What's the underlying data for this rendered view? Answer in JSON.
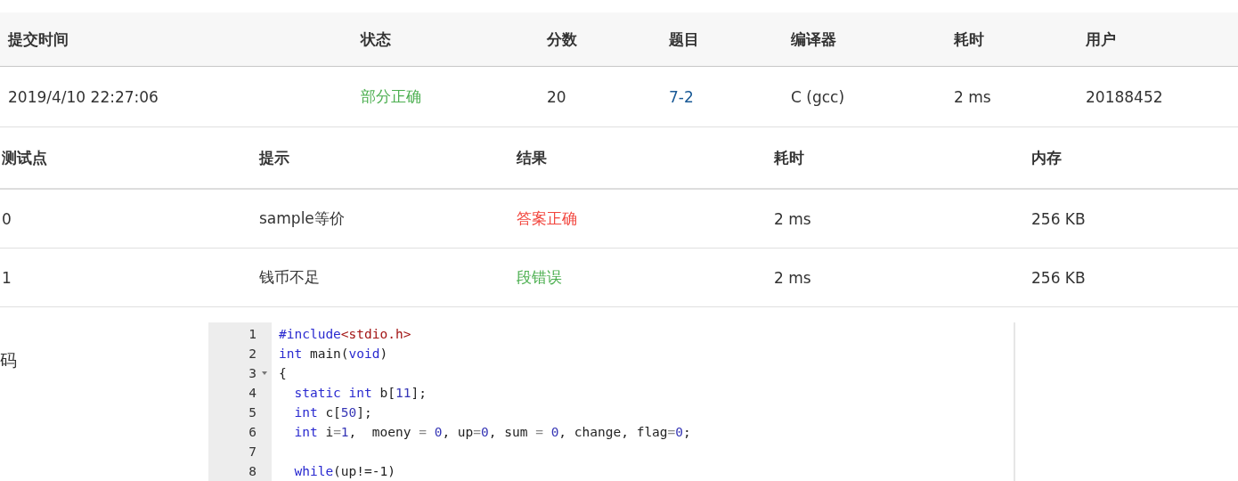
{
  "submission": {
    "columns": [
      "提交时间",
      "状态",
      "分数",
      "题目",
      "编译器",
      "耗时",
      "用户"
    ],
    "row": {
      "time": "2019/4/10 22:27:06",
      "status": {
        "text": "部分正确",
        "color": "#4caf50"
      },
      "score": "20",
      "problem": "7-2",
      "compiler": "C (gcc)",
      "duration": "2 ms",
      "user": "20188452"
    }
  },
  "testcases": {
    "columns": [
      "测试点",
      "提示",
      "结果",
      "耗时",
      "内存"
    ],
    "rows": [
      {
        "id": "0",
        "hint": "sample等价",
        "result": {
          "text": "答案正确",
          "color": "#f2453d"
        },
        "duration": "2 ms",
        "memory": "256 KB"
      },
      {
        "id": "1",
        "hint": "钱币不足",
        "result": {
          "text": "段错误",
          "color": "#4caf50"
        },
        "duration": "2 ms",
        "memory": "256 KB"
      }
    ]
  },
  "code": {
    "label": "码",
    "lines": [
      {
        "number": "1",
        "foldable": false,
        "tokens": [
          {
            "kind": "meta",
            "text": "#include"
          },
          {
            "kind": "str",
            "text": "<stdio.h>"
          }
        ]
      },
      {
        "number": "2",
        "foldable": false,
        "tokens": [
          {
            "kind": "kw",
            "text": "int"
          },
          {
            "kind": "plain",
            "text": " main("
          },
          {
            "kind": "kw",
            "text": "void"
          },
          {
            "kind": "plain",
            "text": ")"
          }
        ]
      },
      {
        "number": "3",
        "foldable": true,
        "tokens": [
          {
            "kind": "plain",
            "text": "{"
          }
        ]
      },
      {
        "number": "4",
        "foldable": false,
        "tokens": [
          {
            "kind": "kw",
            "text": "  static int"
          },
          {
            "kind": "plain",
            "text": " b["
          },
          {
            "kind": "num",
            "text": "11"
          },
          {
            "kind": "plain",
            "text": "];"
          }
        ]
      },
      {
        "number": "5",
        "foldable": false,
        "tokens": [
          {
            "kind": "kw",
            "text": "  int"
          },
          {
            "kind": "plain",
            "text": " c["
          },
          {
            "kind": "num",
            "text": "50"
          },
          {
            "kind": "plain",
            "text": "];"
          }
        ]
      },
      {
        "number": "6",
        "foldable": false,
        "tokens": [
          {
            "kind": "kw",
            "text": "  int"
          },
          {
            "kind": "plain",
            "text": " i"
          },
          {
            "kind": "op",
            "text": "="
          },
          {
            "kind": "num",
            "text": "1"
          },
          {
            "kind": "plain",
            "text": ",  moeny "
          },
          {
            "kind": "op",
            "text": "= "
          },
          {
            "kind": "num",
            "text": "0"
          },
          {
            "kind": "plain",
            "text": ", up"
          },
          {
            "kind": "op",
            "text": "="
          },
          {
            "kind": "num",
            "text": "0"
          },
          {
            "kind": "plain",
            "text": ", sum "
          },
          {
            "kind": "op",
            "text": "= "
          },
          {
            "kind": "num",
            "text": "0"
          },
          {
            "kind": "plain",
            "text": ", change, flag"
          },
          {
            "kind": "op",
            "text": "="
          },
          {
            "kind": "num",
            "text": "0"
          },
          {
            "kind": "plain",
            "text": ";"
          }
        ]
      },
      {
        "number": "7",
        "foldable": false
      },
      {
        "number": "8",
        "foldable": false,
        "tokens": [
          {
            "kind": "kw",
            "text": "  while"
          },
          {
            "kind": "plain",
            "text": "(up!=-1)"
          }
        ]
      }
    ]
  }
}
